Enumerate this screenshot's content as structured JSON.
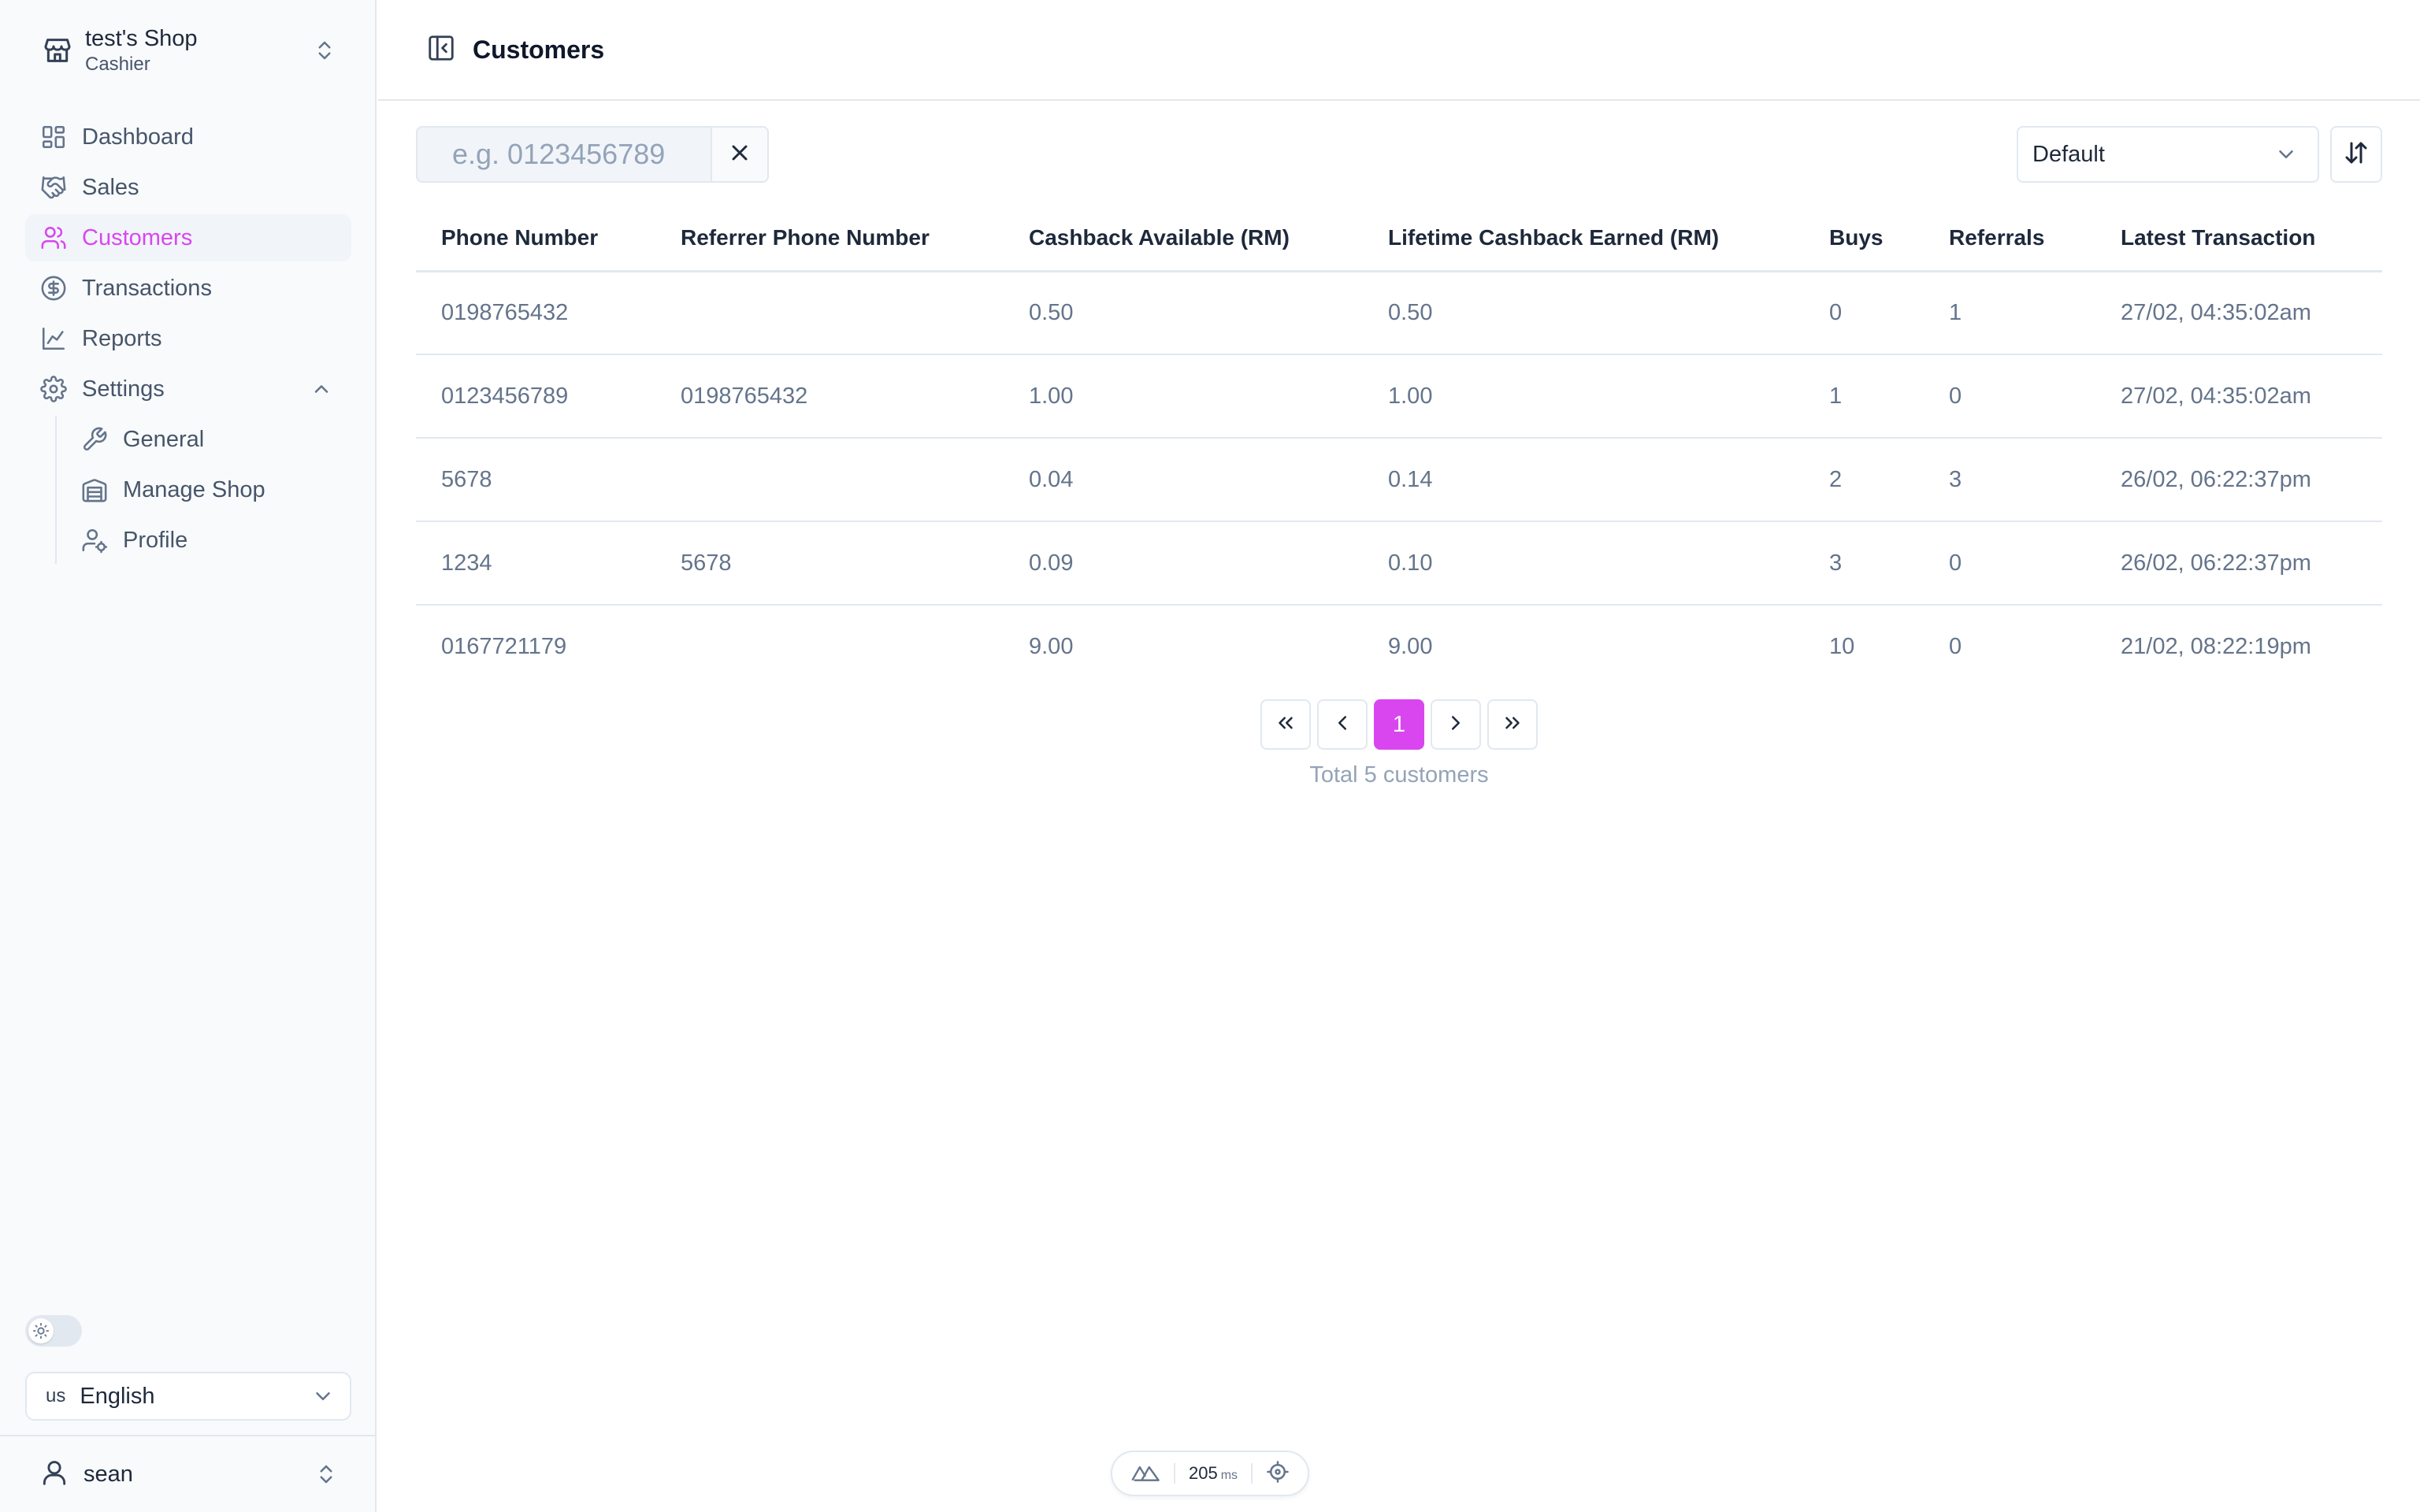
{
  "shop": {
    "name": "test's Shop",
    "role": "Cashier"
  },
  "nav": {
    "items": [
      {
        "label": "Dashboard"
      },
      {
        "label": "Sales"
      },
      {
        "label": "Customers"
      },
      {
        "label": "Transactions"
      },
      {
        "label": "Reports"
      },
      {
        "label": "Settings"
      }
    ],
    "settings_sub": [
      {
        "label": "General"
      },
      {
        "label": "Manage Shop"
      },
      {
        "label": "Profile"
      }
    ]
  },
  "language": {
    "flag": "us",
    "name": "English"
  },
  "user": {
    "name": "sean"
  },
  "page": {
    "title": "Customers"
  },
  "search": {
    "placeholder": "e.g. 0123456789",
    "value": ""
  },
  "sort": {
    "selected": "Default"
  },
  "table": {
    "headers": [
      "Phone Number",
      "Referrer Phone Number",
      "Cashback Available (RM)",
      "Lifetime Cashback Earned (RM)",
      "Buys",
      "Referrals",
      "Latest Transaction"
    ],
    "rows": [
      [
        "0198765432",
        "",
        "0.50",
        "0.50",
        "0",
        "1",
        "27/02, 04:35:02am"
      ],
      [
        "0123456789",
        "0198765432",
        "1.00",
        "1.00",
        "1",
        "0",
        "27/02, 04:35:02am"
      ],
      [
        "5678",
        "",
        "0.04",
        "0.14",
        "2",
        "3",
        "26/02, 06:22:37pm"
      ],
      [
        "1234",
        "5678",
        "0.09",
        "0.10",
        "3",
        "0",
        "26/02, 06:22:37pm"
      ],
      [
        "0167721179",
        "",
        "9.00",
        "9.00",
        "10",
        "0",
        "21/02, 08:22:19pm"
      ]
    ]
  },
  "pagination": {
    "current": "1",
    "total_text": "Total 5 customers"
  },
  "devtools": {
    "ms_value": "205",
    "ms_unit": "ms"
  },
  "colors": {
    "accent": "#d946ef",
    "muted_text": "#64748b",
    "border": "#e2e8f0"
  }
}
